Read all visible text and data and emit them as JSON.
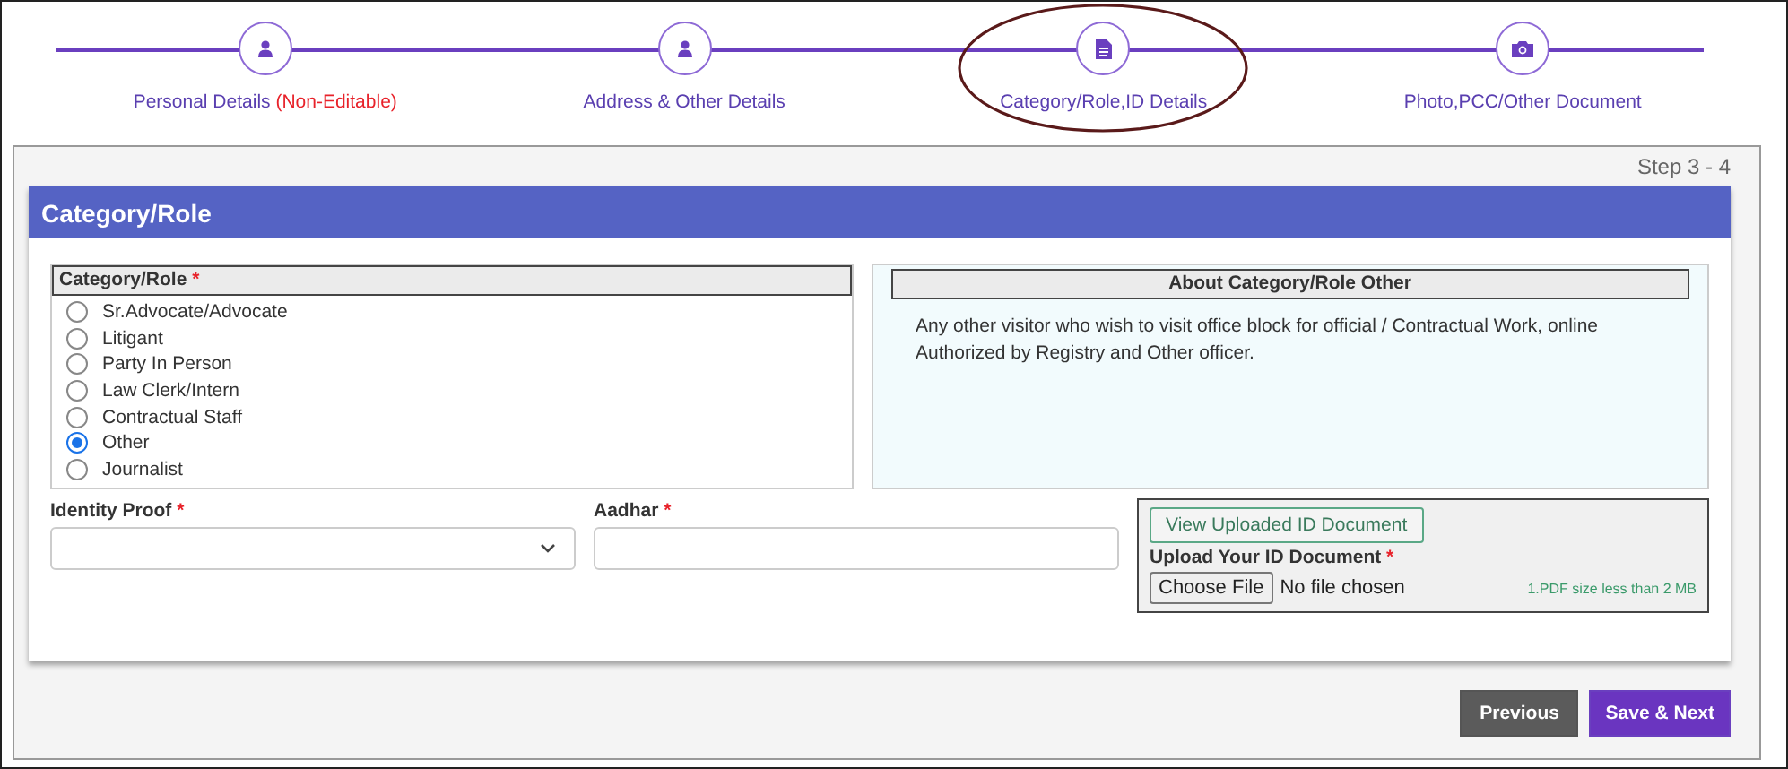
{
  "steps": [
    {
      "kind": "person",
      "label": "Personal Details",
      "note": "(Non-Editable)",
      "circled": false
    },
    {
      "kind": "person",
      "label": "Address & Other Details",
      "circled": false
    },
    {
      "kind": "document",
      "label": "Category/Role,ID Details",
      "circled": true
    },
    {
      "kind": "photo",
      "label": "Photo,PCC/Other Document",
      "circled": false
    }
  ],
  "step_counter": "Step 3 - 4",
  "card": {
    "title": "Category/Role",
    "category": {
      "label": "Category/Role",
      "mark": "*",
      "options": [
        {
          "label": "Sr.Advocate/Advocate",
          "selected": false
        },
        {
          "label": "Litigant",
          "selected": false
        },
        {
          "label": "Party In Person",
          "selected": false
        },
        {
          "label": "Law Clerk/Intern",
          "selected": false
        },
        {
          "label": "Contractual Staff",
          "selected": false
        },
        {
          "label": "Other",
          "selected": true
        },
        {
          "label": "Journalist",
          "selected": false
        }
      ]
    },
    "about": {
      "title": "About Category/Role Other",
      "text": "Any other visitor who wish to visit office block for official / Contractual Work, online Authorized by Registry and Other officer."
    },
    "identity_proof": {
      "label": "Identity Proof",
      "mark": "*"
    },
    "aadhar": {
      "label": "Aadhar",
      "mark": "*"
    },
    "upload": {
      "view_button": "View Uploaded ID Document",
      "label": "Upload Your ID Document",
      "mark": "*",
      "choose_button": "Choose File",
      "file_status": "No file chosen",
      "hint": "1.PDF size less than 2 MB"
    }
  },
  "buttons": [
    {
      "label": "Previous",
      "kind": "secondary"
    },
    {
      "label": "Save & Next",
      "kind": "primary"
    }
  ]
}
